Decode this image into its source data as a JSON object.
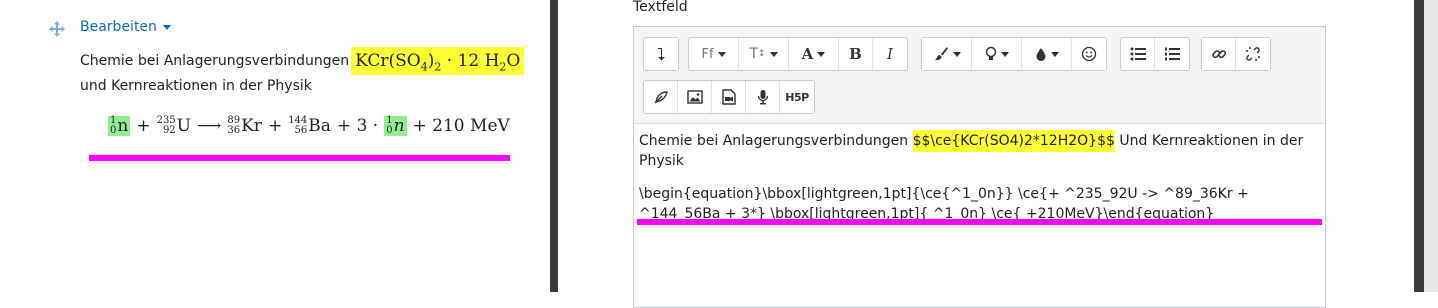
{
  "left": {
    "edit_label": "Bearbeiten",
    "line1_text": "Chemie bei Anlagerungsverbindungen",
    "formula1": {
      "main": "KCr(SO",
      "sub1": "4",
      "close": ")",
      "sub2": "2",
      "dot_12": " · 12 H",
      "sub3": "2",
      "o": "O"
    },
    "line2_text": "und Kernreaktionen in der Physik",
    "equation": {
      "n_top": "1",
      "n_bot": "0",
      "n": "n",
      "plus1": "+",
      "u_top": "235",
      "u_bot": "92",
      "u": "U",
      "arrow": "⟶",
      "kr_top": "89",
      "kr_bot": "36",
      "kr": "Kr",
      "plus2": "+",
      "ba_top": "144",
      "ba_bot": "56",
      "ba": "Ba",
      "plus3": "+ 3 ·",
      "n2_top": "1",
      "n2_bot": "0",
      "n2": "n",
      "energy": "+ 210 MeV"
    }
  },
  "right": {
    "field_label": "Textfeld",
    "content": {
      "p1_before": "Chemie bei Anlagerungsverbindungen ",
      "p1_hl": "$$\\ce{KCr(SO4)2*12H2O}$$",
      "p1_after": " Und Kernreaktionen in der Physik",
      "p2": "\\begin{equation}\\bbox[lightgreen,1pt]{\\ce{^1_0n}} \\ce{+ ^235_92U -> ^89_36Kr + ^144_56Ba + 3*} \\bbox[lightgreen,1pt]{ ^1_0n} \\ce{ +210MeV}\\end{equation}"
    },
    "toolbar": {
      "font_family_label": "Ff",
      "font_size_label": "T",
      "font_color_label": "A",
      "bold_label": "B",
      "italic_label": "I",
      "h5p_label": "H5P"
    }
  },
  "colors": {
    "highlight_yellow": "#ffff33",
    "highlight_green": "#90ee90",
    "marker_pink": "#ff00ff",
    "link_blue": "#0f6cbf"
  }
}
